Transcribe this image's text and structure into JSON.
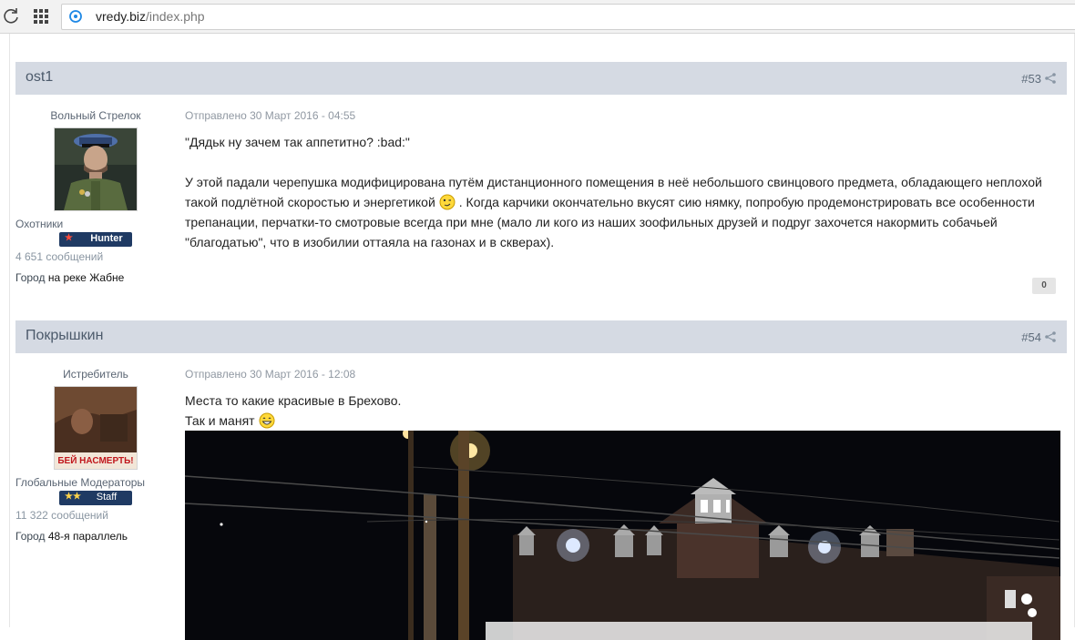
{
  "browser": {
    "url_domain": "vredy.biz",
    "url_path": "/index.php",
    "icons": [
      "reload-icon",
      "apps-icon",
      "site-icon"
    ]
  },
  "posts": [
    {
      "author": "ost1",
      "number": "#53",
      "rank_title": "Вольный Стрелок",
      "group": "Охотники",
      "badge": "Hunter",
      "badge_stars": "★",
      "post_count": "4 651 сообщений",
      "city_label": "Город",
      "city_value": "на реке Жабне",
      "date": "Отправлено 30 Март 2016 - 04:55",
      "line1": "\"Дядьк ну зачем так аппетитно?  :bad:\"",
      "para_a": "У этой падали черепушка модифицирована путём дистанционного помещения в неё небольшого свинцового предмета, обладающего неплохой такой подлётной скоростью и энергетикой",
      "para_b": ". Когда карчики окончательно вкусят сию нямку, попробую продемонстрировать все особенности трепанации, перчатки-то смотровые всегда при мне (мало ли кого из наших зоофильных друзей и подруг захочется накормить собачьей \"благодатью\", что в изобилии оттаяла на газонах и в скверах).",
      "reputation": "0"
    },
    {
      "author": "Покрышкин",
      "number": "#54",
      "rank_title": "Истребитель",
      "avatar_text": "БЕЙ НАСМЕРТЬ!",
      "group": "Глобальные Модераторы",
      "badge": "Staff",
      "badge_stars": "★★",
      "post_count": "11 322 сообщений",
      "city_label": "Город",
      "city_value": "48-я параллель",
      "date": "Отправлено 30 Март 2016 - 12:08",
      "line1": "Места то какие красивые в Брехово.",
      "line2": "Так и манят"
    }
  ],
  "colors": {
    "header_bg": "#d5dae3",
    "badge_bg": "#1f3a63",
    "author_text": "#4c5a6b"
  }
}
